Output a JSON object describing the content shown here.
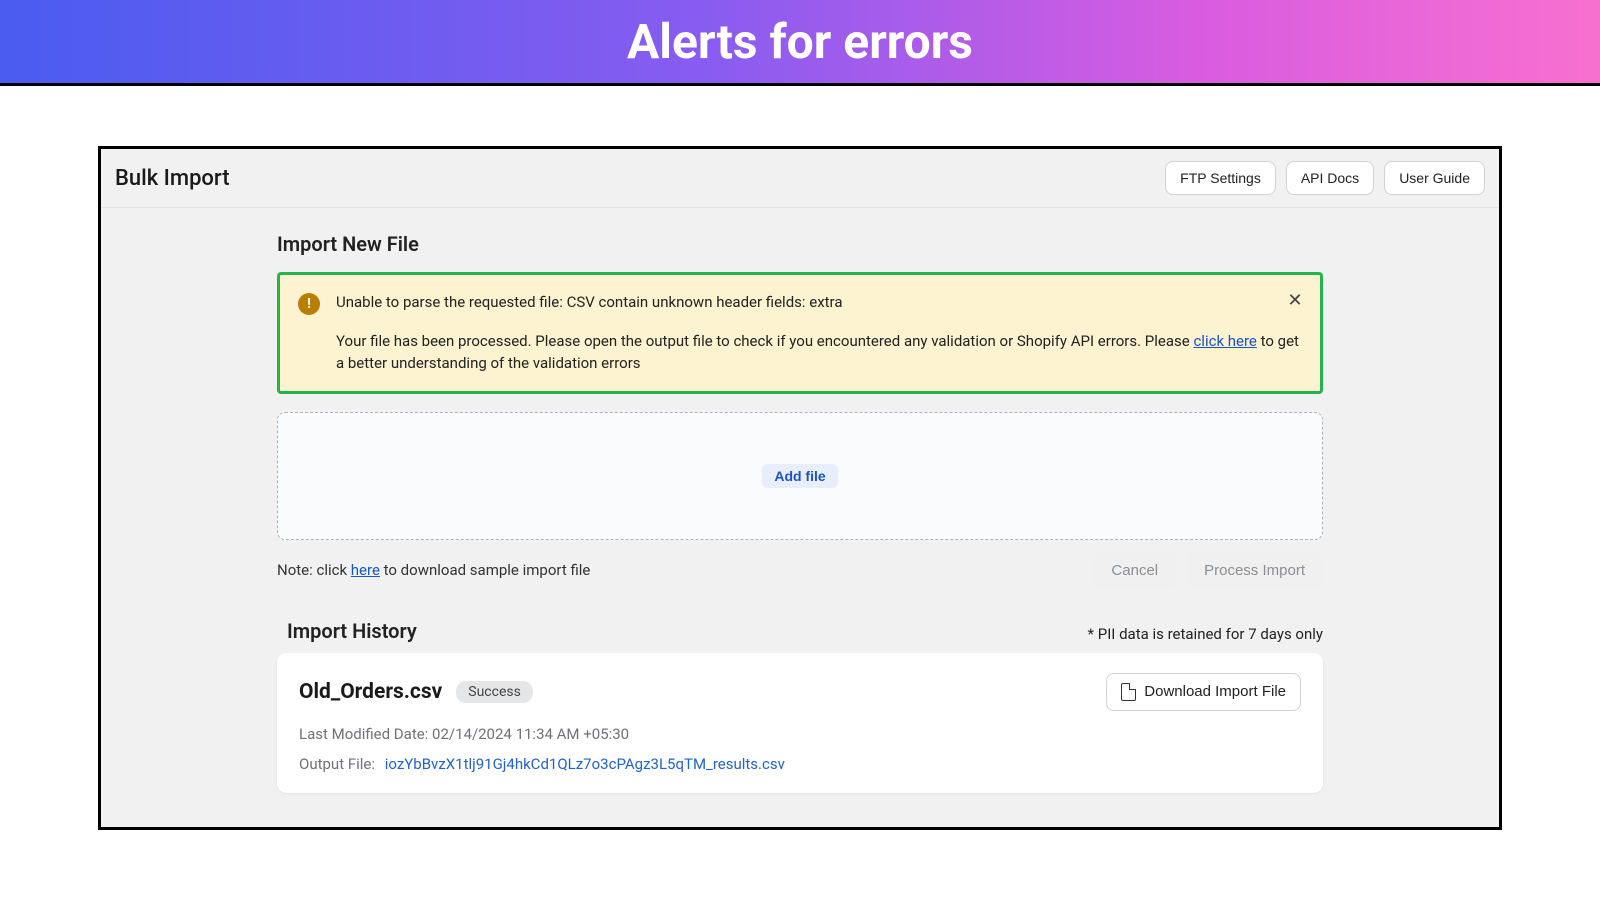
{
  "banner": {
    "title": "Alerts for errors"
  },
  "header": {
    "title": "Bulk Import",
    "buttons": {
      "ftp": "FTP Settings",
      "api": "API Docs",
      "guide": "User Guide"
    }
  },
  "import": {
    "section_title": "Import New File",
    "alert": {
      "line1": "Unable to parse the requested file: CSV contain unknown header fields: extra",
      "line2_pre": "Your file has been processed. Please open the output file to check if you encountered any validation or Shopify API errors. Please ",
      "link": "click here",
      "line2_post": " to get a better understanding of the validation errors"
    },
    "add_file": "Add file",
    "note_pre": "Note: click ",
    "note_link": "here",
    "note_post": " to download sample import file",
    "cancel": "Cancel",
    "process": "Process Import"
  },
  "history": {
    "title": "Import History",
    "pii_note": "* PII data is retained for 7 days only",
    "item": {
      "filename": "Old_Orders.csv",
      "status": "Success",
      "download": "Download Import File",
      "modified_label": "Last Modified Date: ",
      "modified_value": "02/14/2024 11:34 AM +05:30",
      "output_label": "Output File:",
      "output_link": "iozYbBvzX1tlj91Gj4hkCd1QLz7o3cPAgz3L5qTM_results.csv"
    }
  }
}
